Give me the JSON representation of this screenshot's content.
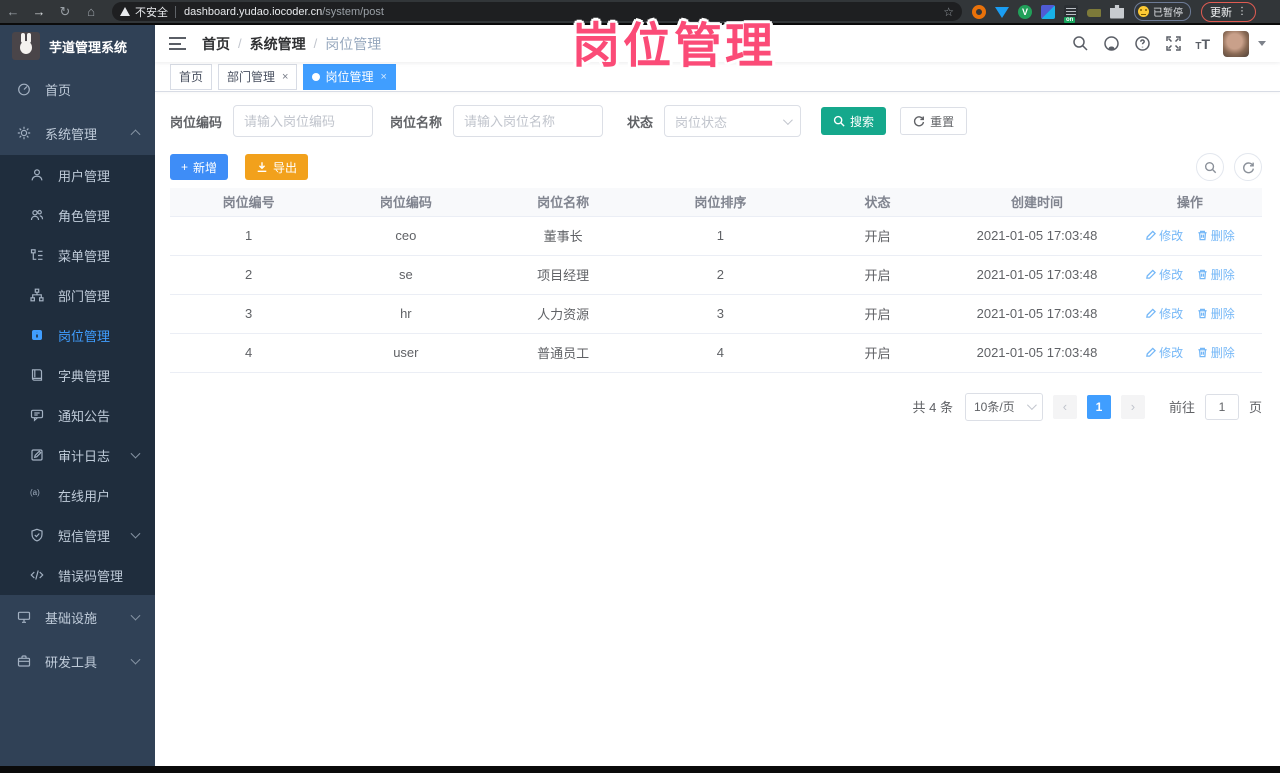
{
  "browser": {
    "security_chip": "不安全",
    "url_host": "dashboard.yudao.iocoder.cn",
    "url_path": "/system/post",
    "star": "☆",
    "back": "←",
    "forward": "→",
    "reload": "↻",
    "home": "⌂",
    "extension_on_badge": "on",
    "extension_green_letter": "V",
    "paused_label": "已暂停",
    "update_label": "更新",
    "kebab": "⋮"
  },
  "watermark": {
    "text": "岗位管理",
    "color": "#fb4b77"
  },
  "sidebar": {
    "title": "芋道管理系统",
    "items": [
      {
        "label": "首页",
        "icon": "dashboard-icon"
      },
      {
        "label": "系统管理",
        "icon": "gear-icon",
        "expanded": true
      },
      {
        "label": "用户管理",
        "icon": "user-icon"
      },
      {
        "label": "角色管理",
        "icon": "users-icon"
      },
      {
        "label": "菜单管理",
        "icon": "menu-tree-icon"
      },
      {
        "label": "部门管理",
        "icon": "org-tree-icon"
      },
      {
        "label": "岗位管理",
        "icon": "post-badge-icon",
        "active": true
      },
      {
        "label": "字典管理",
        "icon": "dictionary-icon"
      },
      {
        "label": "通知公告",
        "icon": "announcement-icon"
      },
      {
        "label": "审计日志",
        "icon": "audit-log-icon",
        "collapsible": true
      },
      {
        "label": "在线用户",
        "icon": "online-user-icon",
        "icon_text": "(a)"
      },
      {
        "label": "短信管理",
        "icon": "sms-shield-icon",
        "collapsible": true
      },
      {
        "label": "错误码管理",
        "icon": "error-code-icon"
      },
      {
        "label": "基础设施",
        "icon": "infrastructure-icon",
        "collapsible": true
      },
      {
        "label": "研发工具",
        "icon": "dev-tools-icon",
        "collapsible": true
      }
    ]
  },
  "breadcrumb": {
    "items": [
      "首页",
      "系统管理",
      "岗位管理"
    ],
    "separator": "/"
  },
  "tags": {
    "close_glyph": "×",
    "items": [
      {
        "label": "首页"
      },
      {
        "label": "部门管理",
        "closable": true
      },
      {
        "label": "岗位管理",
        "closable": true,
        "active": true
      }
    ]
  },
  "search": {
    "code_label": "岗位编码",
    "code_placeholder": "请输入岗位编码",
    "name_label": "岗位名称",
    "name_placeholder": "请输入岗位名称",
    "status_label": "状态",
    "status_placeholder": "岗位状态",
    "search_button": "搜索",
    "reset_button": "重置"
  },
  "toolbar": {
    "add_button": "新增",
    "add_plus": "+",
    "export_button": "导出"
  },
  "table": {
    "headers": [
      "岗位编号",
      "岗位编码",
      "岗位名称",
      "岗位排序",
      "状态",
      "创建时间",
      "操作"
    ],
    "rows": [
      {
        "id": "1",
        "code": "ceo",
        "name": "董事长",
        "sort": "1",
        "status": "开启",
        "created": "2021-01-05 17:03:48"
      },
      {
        "id": "2",
        "code": "se",
        "name": "项目经理",
        "sort": "2",
        "status": "开启",
        "created": "2021-01-05 17:03:48"
      },
      {
        "id": "3",
        "code": "hr",
        "name": "人力资源",
        "sort": "3",
        "status": "开启",
        "created": "2021-01-05 17:03:48"
      },
      {
        "id": "4",
        "code": "user",
        "name": "普通员工",
        "sort": "4",
        "status": "开启",
        "created": "2021-01-05 17:03:48"
      }
    ],
    "edit_label": "修改",
    "delete_label": "删除"
  },
  "pagination": {
    "total": "共 4 条",
    "page_size": "10条/页",
    "prev": "‹",
    "next": "›",
    "current_page": "1",
    "goto_label": "前往",
    "goto_value": "1",
    "page_unit": "页"
  },
  "colors": {
    "accent_blue": "#409eff",
    "search_teal": "#15a88c",
    "export_orange": "#f2a11c",
    "sidebar_bg": "#304156",
    "submenu_bg": "#1f2d3d",
    "watermark_pink": "#fb4b77"
  }
}
